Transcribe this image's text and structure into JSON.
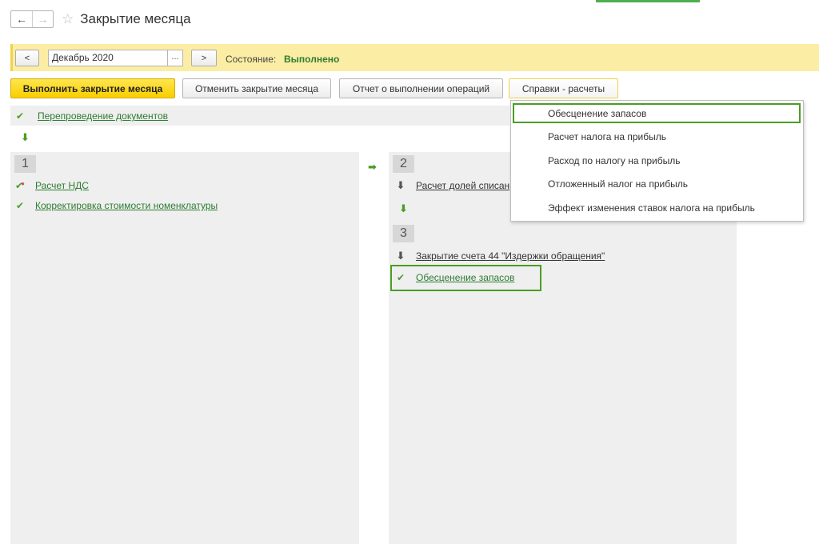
{
  "window": {
    "title": "Закрытие месяца",
    "nav_back": "←",
    "nav_forward": "→",
    "favorite_icon": "☆"
  },
  "period_bar": {
    "prev_label": "<",
    "next_label": ">",
    "period_value": "Декабрь 2020",
    "picker_label": "...",
    "state_label": "Состояние:",
    "state_value": "Выполнено"
  },
  "toolbar": {
    "run_label": "Выполнить закрытие месяца",
    "cancel_label": "Отменить закрытие месяца",
    "report_label": "Отчет о выполнении операций",
    "references_label": "Справки - расчеты"
  },
  "reposting": {
    "label": "Перепроведение документов"
  },
  "stage1": {
    "number": "1",
    "items": [
      {
        "label": "Расчет НДС",
        "icon": "check-warning-icon"
      },
      {
        "label": "Корректировка стоимости номенклатуры",
        "icon": "check-icon"
      }
    ]
  },
  "stage2": {
    "number": "2",
    "items": [
      {
        "label": "Расчет долей списан",
        "icon": "arrow-down-icon"
      }
    ]
  },
  "stage3": {
    "number": "3",
    "items": [
      {
        "label": "Закрытие счета 44 \"Издержки обращения\"",
        "icon": "arrow-down-icon"
      },
      {
        "label": "Обесценение запасов",
        "icon": "check-icon"
      }
    ]
  },
  "dropdown": {
    "items": [
      "Обесценение запасов",
      "Расчет налога на прибыль",
      "Расход по налогу на прибыль",
      "Отложенный налог на прибыль",
      "Эффект изменения ставок налога на прибыль"
    ]
  },
  "colors": {
    "accent_green": "#4a9d24",
    "link_green": "#2e7d32",
    "yellow_bar": "#fbeda3",
    "primary_button": "#f8cf00"
  }
}
